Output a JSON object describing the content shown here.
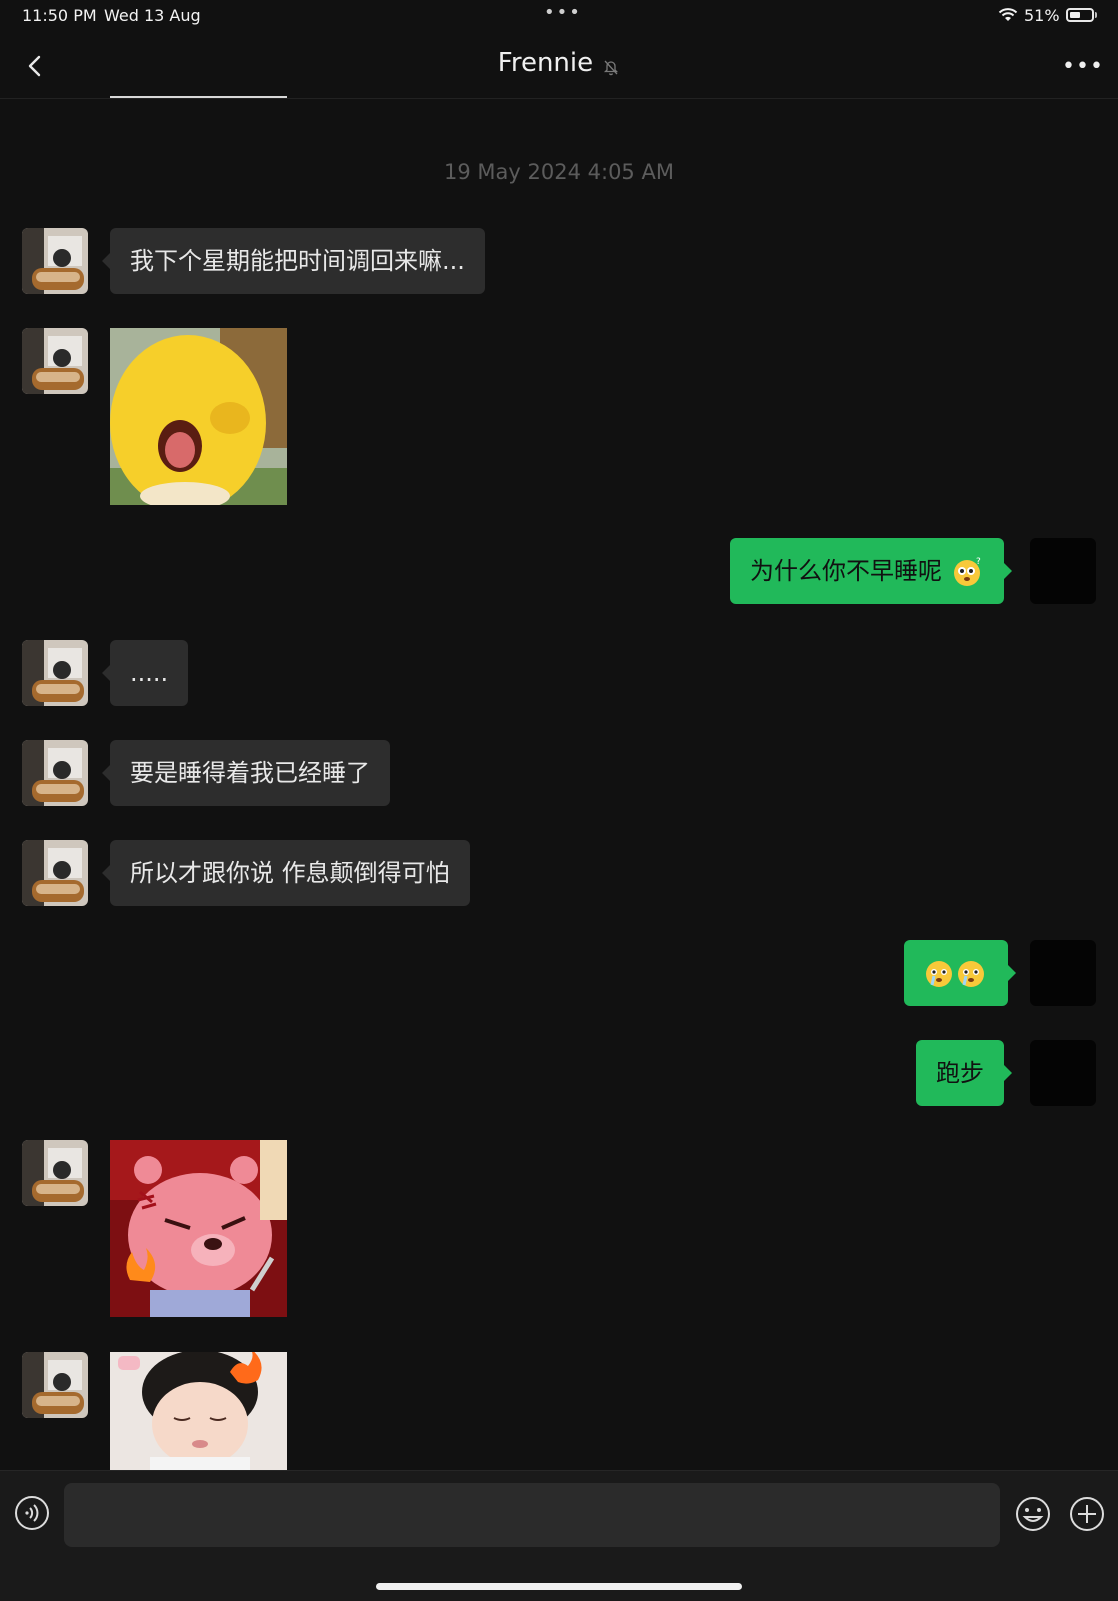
{
  "status_bar": {
    "time": "11:50 PM",
    "date": "Wed 13 Aug",
    "dots": "•••",
    "battery_percent": "51%",
    "battery_level": 0.51
  },
  "header": {
    "title": "Frennie",
    "more": "•••"
  },
  "chat": {
    "timestamp": "19 May 2024 4:05 AM",
    "messages": [
      {
        "from": "them",
        "type": "text",
        "text": "我下个星期能把时间调回来嘛..."
      },
      {
        "from": "them",
        "type": "sticker",
        "sticker": "yellow-character-yawning"
      },
      {
        "from": "me",
        "type": "text",
        "text": "为什么你不早睡呢"
      },
      {
        "from": "them",
        "type": "text",
        "text": "....."
      },
      {
        "from": "them",
        "type": "text",
        "text": "要是睡得着我已经睡了"
      },
      {
        "from": "them",
        "type": "text",
        "text": "所以才跟你说 作息颠倒得可怕"
      },
      {
        "from": "me",
        "type": "emoji",
        "text": ""
      },
      {
        "from": "me",
        "type": "text",
        "text": "跑步"
      },
      {
        "from": "them",
        "type": "sticker",
        "sticker": "angry-pink-beaver-with-knife"
      },
      {
        "from": "them",
        "type": "sticker",
        "sticker": "sleepy-baby-with-fire"
      }
    ]
  },
  "input": {
    "placeholder": ""
  },
  "colors": {
    "background": "#111111",
    "incoming_bubble": "#2d2d2d",
    "outgoing_bubble": "#21b95a",
    "timestamp": "#5c5c5c"
  }
}
